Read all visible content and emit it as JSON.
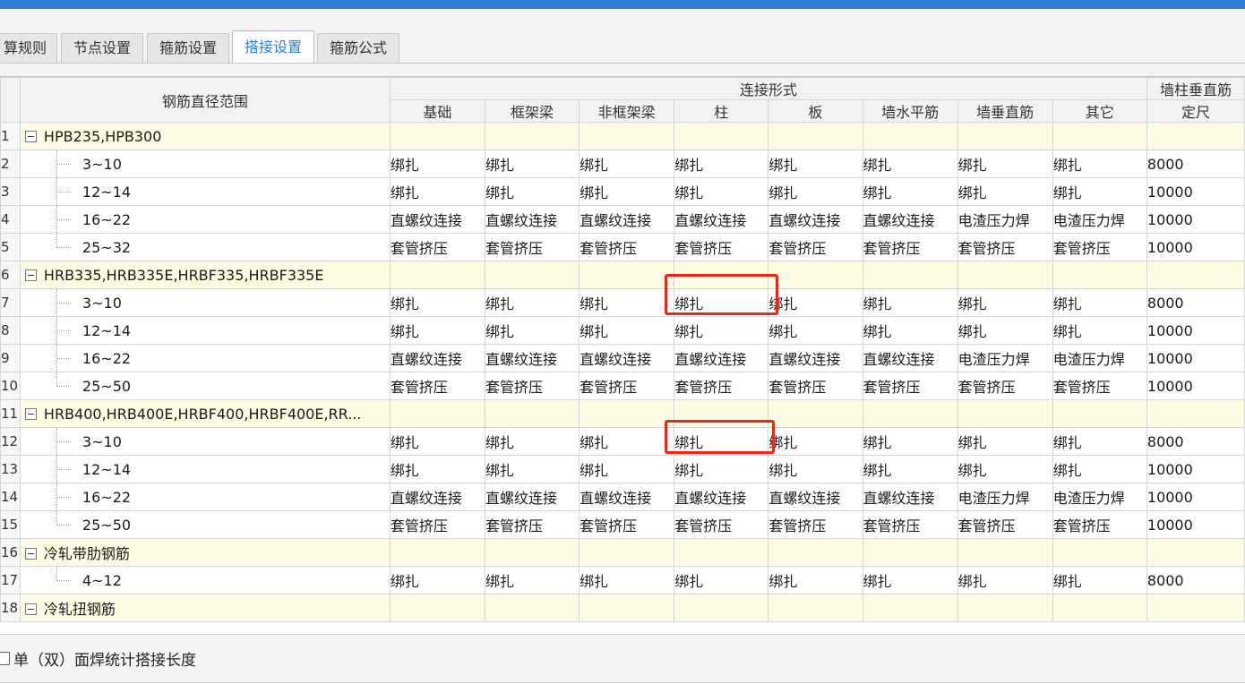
{
  "tabs": [
    {
      "label": "算规则",
      "active": false
    },
    {
      "label": "节点设置",
      "active": false
    },
    {
      "label": "箍筋设置",
      "active": false
    },
    {
      "label": "搭接设置",
      "active": true
    },
    {
      "label": "箍筋公式",
      "active": false
    }
  ],
  "header": {
    "diameter_range": "钢筋直径范围",
    "connection_form": "连接形式",
    "wall_col_line1": "墙柱垂直筋",
    "wall_col_line2": "定尺",
    "columns": [
      "基础",
      "框架梁",
      "非框架梁",
      "柱",
      "板",
      "墙水平筋",
      "墙垂直筋",
      "其它"
    ]
  },
  "rows": [
    {
      "idx": "1",
      "type": "group",
      "name": "HPB235,HPB300"
    },
    {
      "idx": "2",
      "type": "item",
      "range": "3~10",
      "cells": [
        "绑扎",
        "绑扎",
        "绑扎",
        "绑扎",
        "绑扎",
        "绑扎",
        "绑扎",
        "绑扎"
      ],
      "length": "8000"
    },
    {
      "idx": "3",
      "type": "item",
      "range": "12~14",
      "cells": [
        "绑扎",
        "绑扎",
        "绑扎",
        "绑扎",
        "绑扎",
        "绑扎",
        "绑扎",
        "绑扎"
      ],
      "length": "10000"
    },
    {
      "idx": "4",
      "type": "item",
      "range": "16~22",
      "cells": [
        "直螺纹连接",
        "直螺纹连接",
        "直螺纹连接",
        "直螺纹连接",
        "直螺纹连接",
        "直螺纹连接",
        "电渣压力焊",
        "电渣压力焊"
      ],
      "length": "10000"
    },
    {
      "idx": "5",
      "type": "item",
      "range": "25~32",
      "cells": [
        "套管挤压",
        "套管挤压",
        "套管挤压",
        "套管挤压",
        "套管挤压",
        "套管挤压",
        "套管挤压",
        "套管挤压"
      ],
      "length": "10000",
      "last": true
    },
    {
      "idx": "6",
      "type": "group",
      "name": "HRB335,HRB335E,HRBF335,HRBF335E"
    },
    {
      "idx": "7",
      "type": "item",
      "range": "3~10",
      "cells": [
        "绑扎",
        "绑扎",
        "绑扎",
        "绑扎",
        "绑扎",
        "绑扎",
        "绑扎",
        "绑扎"
      ],
      "length": "8000"
    },
    {
      "idx": "8",
      "type": "item",
      "range": "12~14",
      "cells": [
        "绑扎",
        "绑扎",
        "绑扎",
        "绑扎",
        "绑扎",
        "绑扎",
        "绑扎",
        "绑扎"
      ],
      "length": "10000"
    },
    {
      "idx": "9",
      "type": "item",
      "range": "16~22",
      "cells": [
        "直螺纹连接",
        "直螺纹连接",
        "直螺纹连接",
        "直螺纹连接",
        "直螺纹连接",
        "直螺纹连接",
        "电渣压力焊",
        "电渣压力焊"
      ],
      "length": "10000"
    },
    {
      "idx": "10",
      "type": "item",
      "range": "25~50",
      "cells": [
        "套管挤压",
        "套管挤压",
        "套管挤压",
        "套管挤压",
        "套管挤压",
        "套管挤压",
        "套管挤压",
        "套管挤压"
      ],
      "length": "10000",
      "last": true
    },
    {
      "idx": "11",
      "type": "group",
      "name": "HRB400,HRB400E,HRBF400,HRBF400E,RR..."
    },
    {
      "idx": "12",
      "type": "item",
      "range": "3~10",
      "cells": [
        "绑扎",
        "绑扎",
        "绑扎",
        "绑扎",
        "绑扎",
        "绑扎",
        "绑扎",
        "绑扎"
      ],
      "length": "8000"
    },
    {
      "idx": "13",
      "type": "item",
      "range": "12~14",
      "cells": [
        "绑扎",
        "绑扎",
        "绑扎",
        "绑扎",
        "绑扎",
        "绑扎",
        "绑扎",
        "绑扎"
      ],
      "length": "10000"
    },
    {
      "idx": "14",
      "type": "item",
      "range": "16~22",
      "cells": [
        "直螺纹连接",
        "直螺纹连接",
        "直螺纹连接",
        "直螺纹连接",
        "直螺纹连接",
        "直螺纹连接",
        "电渣压力焊",
        "电渣压力焊"
      ],
      "length": "10000"
    },
    {
      "idx": "15",
      "type": "item",
      "range": "25~50",
      "cells": [
        "套管挤压",
        "套管挤压",
        "套管挤压",
        "套管挤压",
        "套管挤压",
        "套管挤压",
        "套管挤压",
        "套管挤压"
      ],
      "length": "10000",
      "last": true
    },
    {
      "idx": "16",
      "type": "group",
      "name": "冷轧带肋钢筋"
    },
    {
      "idx": "17",
      "type": "item",
      "range": "4~12",
      "cells": [
        "绑扎",
        "绑扎",
        "绑扎",
        "绑扎",
        "绑扎",
        "绑扎",
        "绑扎",
        "绑扎"
      ],
      "length": "8000",
      "last": true
    },
    {
      "idx": "18",
      "type": "group",
      "name": "冷轧扭钢筋"
    }
  ],
  "footer": {
    "checkbox_label": "单（双）面焊统计搭接长度",
    "checked": false
  },
  "colors": {
    "accent": "#2f7fd8",
    "group_row": "#fefce3",
    "highlight": "#e5271c"
  }
}
